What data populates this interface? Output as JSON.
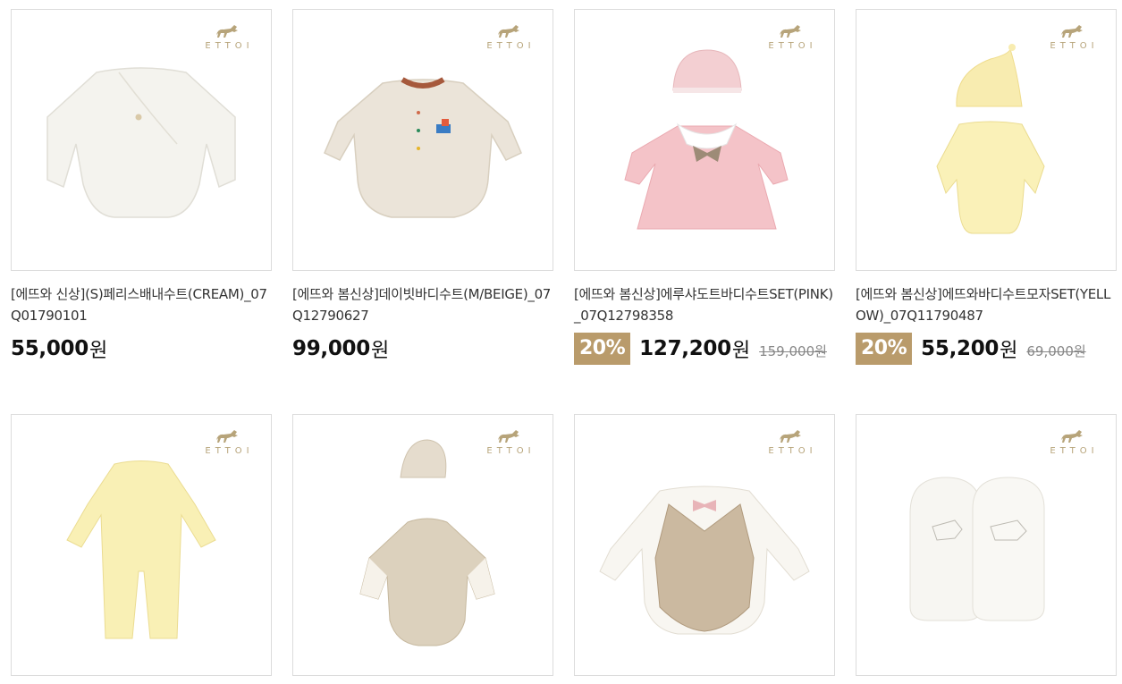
{
  "brand_logo_text": "ETTOI",
  "products": [
    {
      "title": "[에뜨와 신상](S)페리스배내수트(CREAM)_07Q01790101",
      "discount": "",
      "price": "55,000",
      "currency": "원",
      "original_price": "",
      "image_icon": "cream-bodysuit-image"
    },
    {
      "title": "[에뜨와 봄신상]데이빗바디수트(M/BEIGE)_07Q12790627",
      "discount": "",
      "price": "99,000",
      "currency": "원",
      "original_price": "",
      "image_icon": "beige-romper-image"
    },
    {
      "title": "[에뜨와 봄신상]에루샤도트바디수트SET(PINK)_07Q12798358",
      "discount": "20%",
      "price": "127,200",
      "currency": "원",
      "original_price": "159,000원",
      "image_icon": "pink-dress-set-image"
    },
    {
      "title": "[에뜨와 봄신상]에뜨와바디수트모자SET(YELLOW)_07Q11790487",
      "discount": "20%",
      "price": "55,200",
      "currency": "원",
      "original_price": "69,000원",
      "image_icon": "yellow-bodysuit-hat-image"
    },
    {
      "image_icon": "yellow-jumpsuit-image"
    },
    {
      "image_icon": "patterned-romper-bonnet-image"
    },
    {
      "image_icon": "vest-bowtie-romper-image"
    },
    {
      "image_icon": "white-mittens-image"
    }
  ],
  "colors": {
    "badge": "#b99b6b",
    "logo_gold": "#b7a47a",
    "border": "#dcdcdc"
  }
}
